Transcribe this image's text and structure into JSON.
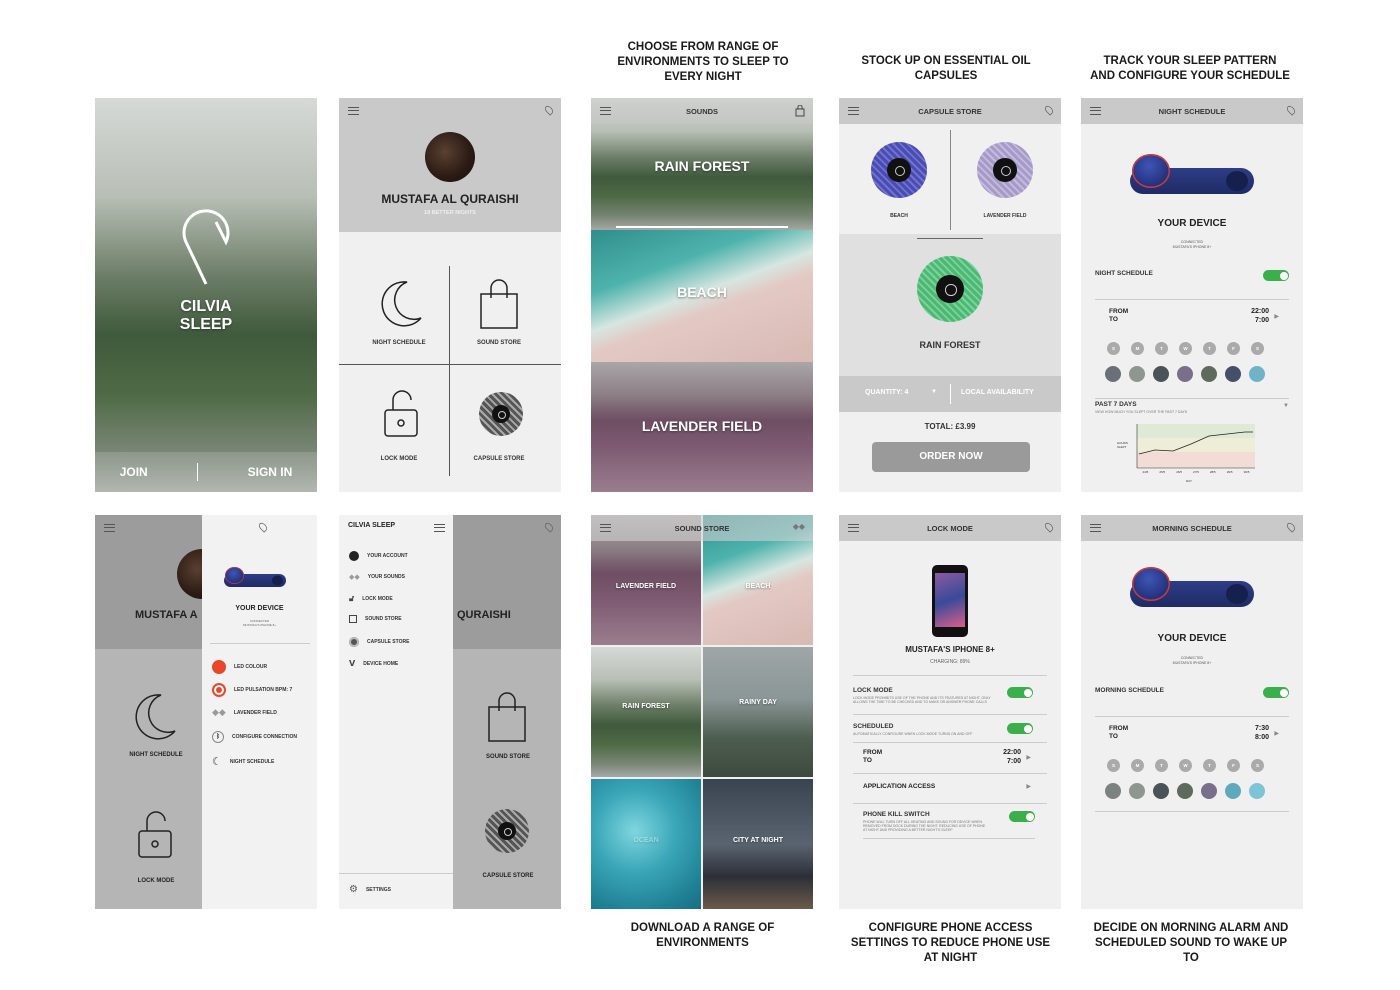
{
  "captions": {
    "top_sounds": "CHOOSE FROM RANGE OF ENVIRONMENTS TO SLEEP TO EVERY NIGHT",
    "top_capsules": "STOCK UP ON ESSENTIAL OIL CAPSULES",
    "top_track": "TRACK YOUR SLEEP PATTERN AND CONFIGURE YOUR SCHEDULE",
    "bottom_download": "DOWNLOAD A RANGE OF ENVIRONMENTS",
    "bottom_configure": "CONFIGURE PHONE ACCESS SETTINGS TO REDUCE PHONE USE AT NIGHT",
    "bottom_morning": "DECIDE ON MORNING ALARM AND SCHEDULED SOUND TO WAKE UP TO"
  },
  "splash": {
    "brand_line1": "CILVIA",
    "brand_line2": "SLEEP",
    "join": "JOIN",
    "sign_in": "SIGN IN"
  },
  "home": {
    "name": "MUSTAFA AL QURAISHI",
    "sub": "18 BETTER NIGHTS",
    "tiles": [
      "NIGHT SCHEDULE",
      "SOUND STORE",
      "LOCK MODE",
      "CAPSULE STORE"
    ]
  },
  "sounds": {
    "title": "SOUNDS",
    "items": [
      "RAIN FOREST",
      "BEACH",
      "LAVENDER FIELD"
    ]
  },
  "capsule_store": {
    "title": "CAPSULE STORE",
    "small": [
      "BEACH",
      "LAVENDER FIELD"
    ],
    "selected": "RAIN FOREST",
    "quantity": "QUANTITY: 4",
    "availability": "LOCAL AVAILABILITY",
    "total": "TOTAL: £3.99",
    "order": "ORDER NOW"
  },
  "night_schedule": {
    "title": "NIGHT SCHEDULE",
    "device": "YOUR DEVICE",
    "connected": "CONNECTED",
    "phone": "MUSTAFA'S IPHONE 8+",
    "row_title": "NIGHT SCHEDULE",
    "from_label": "FROM",
    "to_label": "TO",
    "from": "22:00",
    "to": "7:00",
    "days": [
      "S",
      "M",
      "T",
      "W",
      "T",
      "F",
      "S"
    ],
    "past_title": "PAST 7 DAYS",
    "past_desc": "VIEW HOW MUCH YOU SLEPT OVER THE PAST 7 DAYS",
    "y_label": "HOURS SLEPT",
    "x_label": "DAY",
    "x_ticks": [
      "24/5",
      "25/5",
      "26/5",
      "27/5",
      "28/5",
      "29/5",
      "30/5"
    ]
  },
  "device_panel": {
    "device": "YOUR DEVICE",
    "connected": "CONNECTED",
    "phone": "MUSTAFA'S IPHONE 8+",
    "items": [
      "LED COLOUR",
      "LED PULSATION BPM: 7",
      "LAVENDER FIELD",
      "CONFIGURE CONNECTION",
      "NIGHT SCHEDULE"
    ],
    "bg_name": "MUSTAFA A",
    "bg_tiles": [
      "NIGHT SCHEDULE",
      "LOCK MODE"
    ]
  },
  "menu": {
    "title": "CILVIA SLEEP",
    "items": [
      "YOUR ACCOUNT",
      "YOUR SOUNDS",
      "LOCK MODE",
      "SOUND STORE",
      "CAPSULE STORE",
      "DEVICE HOME"
    ],
    "settings": "SETTINGS",
    "bg_name": "QURAISHI",
    "bg_tiles": [
      "SOUND STORE",
      "CAPSULE STORE"
    ]
  },
  "sound_store": {
    "title": "SOUND STORE",
    "items": [
      "LAVENDER FIELD",
      "BEACH",
      "RAIN FOREST",
      "RAINY DAY",
      "OCEAN",
      "CITY AT NIGHT"
    ]
  },
  "lock_mode": {
    "title": "LOCK MODE",
    "phone": "MUSTAFA'S IPHONE 8+",
    "charging": "CHARGING: 89%",
    "rows": [
      {
        "title": "LOCK MODE",
        "desc": "LOCK MODE PROHIBITS USE OF THE PHONE AND ITS FEATURES AT NIGHT, ONLY ALLOWS THE TIME TO BE CHECKED AND TO MAKE OR ANSWER PHONE CALLS"
      },
      {
        "title": "SCHEDULED",
        "desc": "AUTOMATICALLY CONFIGURE WHEN LOCK MODE TURNS ON AND OFF"
      }
    ],
    "from_label": "FROM",
    "to_label": "TO",
    "from": "22:00",
    "to": "7:00",
    "app_access": "APPLICATION ACCESS",
    "kill_title": "PHONE KILL SWITCH",
    "kill_desc": "PHONE WILL TURN OFF ALL HEATING AND SOUND FOR DEVICE WHEN REMOVED FROM DOCK DURING THE NIGHT. REDUCING USE OF PHONE AT NIGHT AND PROVIDING A BETTER NIGHT'S SLEEP"
  },
  "morning_schedule": {
    "title": "MORNING SCHEDULE",
    "device": "YOUR DEVICE",
    "connected": "CONNECTED",
    "phone": "MUSTAFA'S IPHONE 8+",
    "row_title": "MORNING SCHEDULE",
    "from_label": "FROM",
    "to_label": "TO",
    "from": "7:30",
    "to": "8:00",
    "days": [
      "S",
      "M",
      "T",
      "W",
      "T",
      "F",
      "S"
    ]
  }
}
